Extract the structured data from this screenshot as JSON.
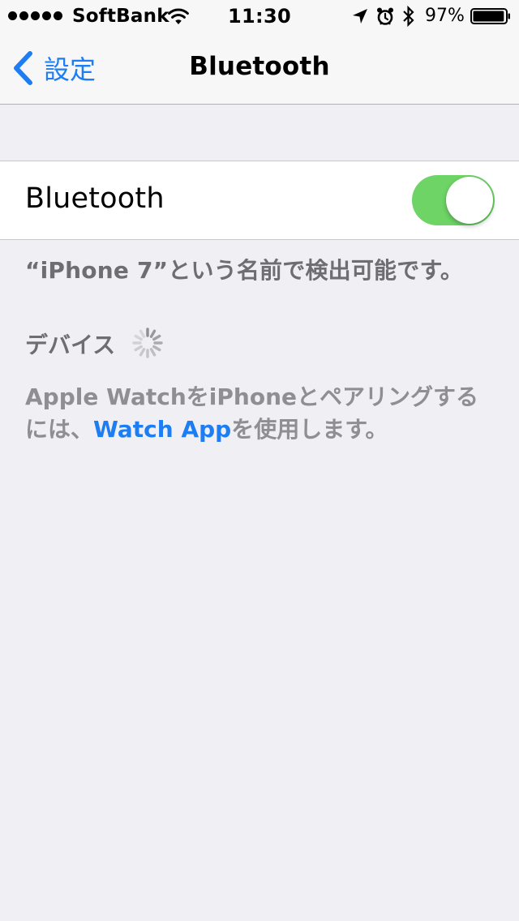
{
  "status_bar": {
    "carrier": "SoftBank",
    "time": "11:30",
    "battery_percent": "97%",
    "signal_bars": 5,
    "battery_level": 0.97,
    "icons": [
      "wifi-icon",
      "location-arrow-icon",
      "alarm-clock-icon",
      "bluetooth-icon",
      "battery-icon"
    ]
  },
  "nav": {
    "back_label": "設定",
    "title": "Bluetooth"
  },
  "toggle": {
    "label": "Bluetooth",
    "on": true,
    "on_color": "#6dd465"
  },
  "discoverable_text": "“iPhone 7”という名前で検出可能です。",
  "devices": {
    "header": "デバイス"
  },
  "footer": {
    "text_before": "Apple WatchをiPhoneとペアリングするには、",
    "link": "Watch App",
    "text_after": "を使用します。"
  },
  "colors": {
    "accent": "#1d7df2",
    "background": "#efeff4",
    "secondary_text": "#6d6d72"
  }
}
